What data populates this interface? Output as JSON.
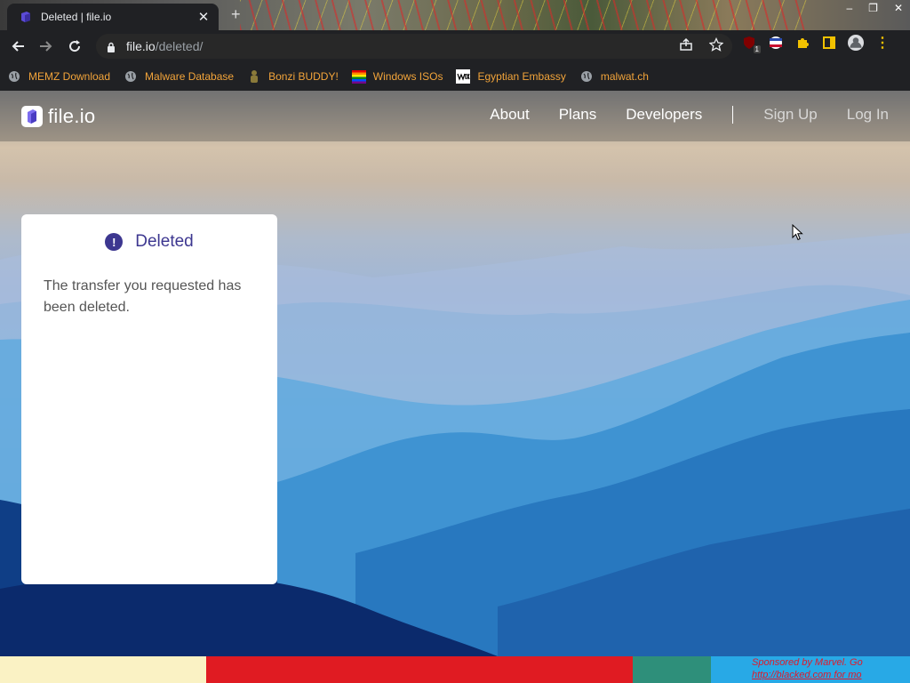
{
  "browser": {
    "tab_title": "Deleted | file.io",
    "new_tab": "+",
    "url_host": "file.io",
    "url_path": "/deleted/",
    "extension_badge": "1",
    "window_controls": [
      "–",
      "❐",
      "✕"
    ],
    "bookmarks": [
      {
        "label": "MEMZ Download",
        "icon": "globe-icon"
      },
      {
        "label": "Malware Database",
        "icon": "globe-icon"
      },
      {
        "label": "Bonzi BUDDY!",
        "icon": "bonzi-icon"
      },
      {
        "label": "Windows ISOs",
        "icon": "windows-icon"
      },
      {
        "label": "Egyptian Embassy",
        "icon": "wix-icon"
      },
      {
        "label": "malwat.ch",
        "icon": "globe-icon"
      }
    ]
  },
  "site": {
    "logo_text": "file.io",
    "nav": {
      "about": "About",
      "plans": "Plans",
      "developers": "Developers",
      "sign_up": "Sign Up",
      "log_in": "Log In"
    }
  },
  "card": {
    "icon_glyph": "!",
    "title": "Deleted",
    "message": "The transfer you requested has been deleted."
  },
  "banner": {
    "line1": "Sponsored by Marvel. Go",
    "line2": "http://blacked.com for mo"
  },
  "colors": {
    "accent": "#3d3790",
    "bookmark_text": "#f2a43a",
    "chrome_bg": "#202124"
  }
}
